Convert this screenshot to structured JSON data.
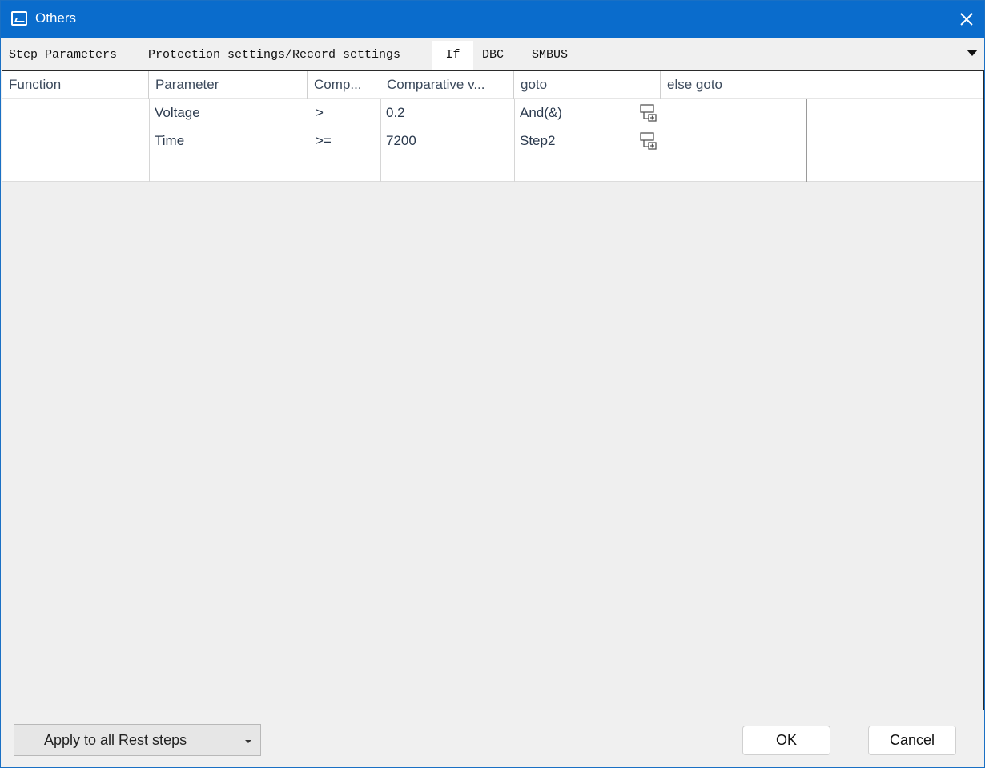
{
  "window": {
    "title": "Others",
    "app_icon": "app-logo-icon",
    "close_icon": "close-icon"
  },
  "tabs": [
    {
      "label": "Step Parameters",
      "active": false
    },
    {
      "label": "Protection settings/Record settings",
      "active": false
    },
    {
      "label": "If",
      "active": true
    },
    {
      "label": "DBC",
      "active": false
    },
    {
      "label": "SMBUS",
      "active": false
    }
  ],
  "tab_overflow_icon": "triangle-down-icon",
  "table": {
    "columns": [
      "Function",
      "Parameter",
      "Comp...",
      "Comparative v...",
      "goto",
      "else goto"
    ],
    "rows": [
      {
        "function": "",
        "parameter": "Voltage",
        "comp": ">",
        "value": "0.2",
        "goto": "And(&)",
        "else_goto": "",
        "goto_icon": "add-step-icon"
      },
      {
        "function": "",
        "parameter": "Time",
        "comp": ">=",
        "value": "7200",
        "goto": "Step2",
        "else_goto": "",
        "goto_icon": "add-step-icon"
      }
    ]
  },
  "footer": {
    "apply_label": "Apply to all Rest steps",
    "ok_label": "OK",
    "cancel_label": "Cancel"
  },
  "colors": {
    "titlebar": "#0a6ccc",
    "background": "#f0f0f0",
    "header_text": "#3c4a5c"
  }
}
